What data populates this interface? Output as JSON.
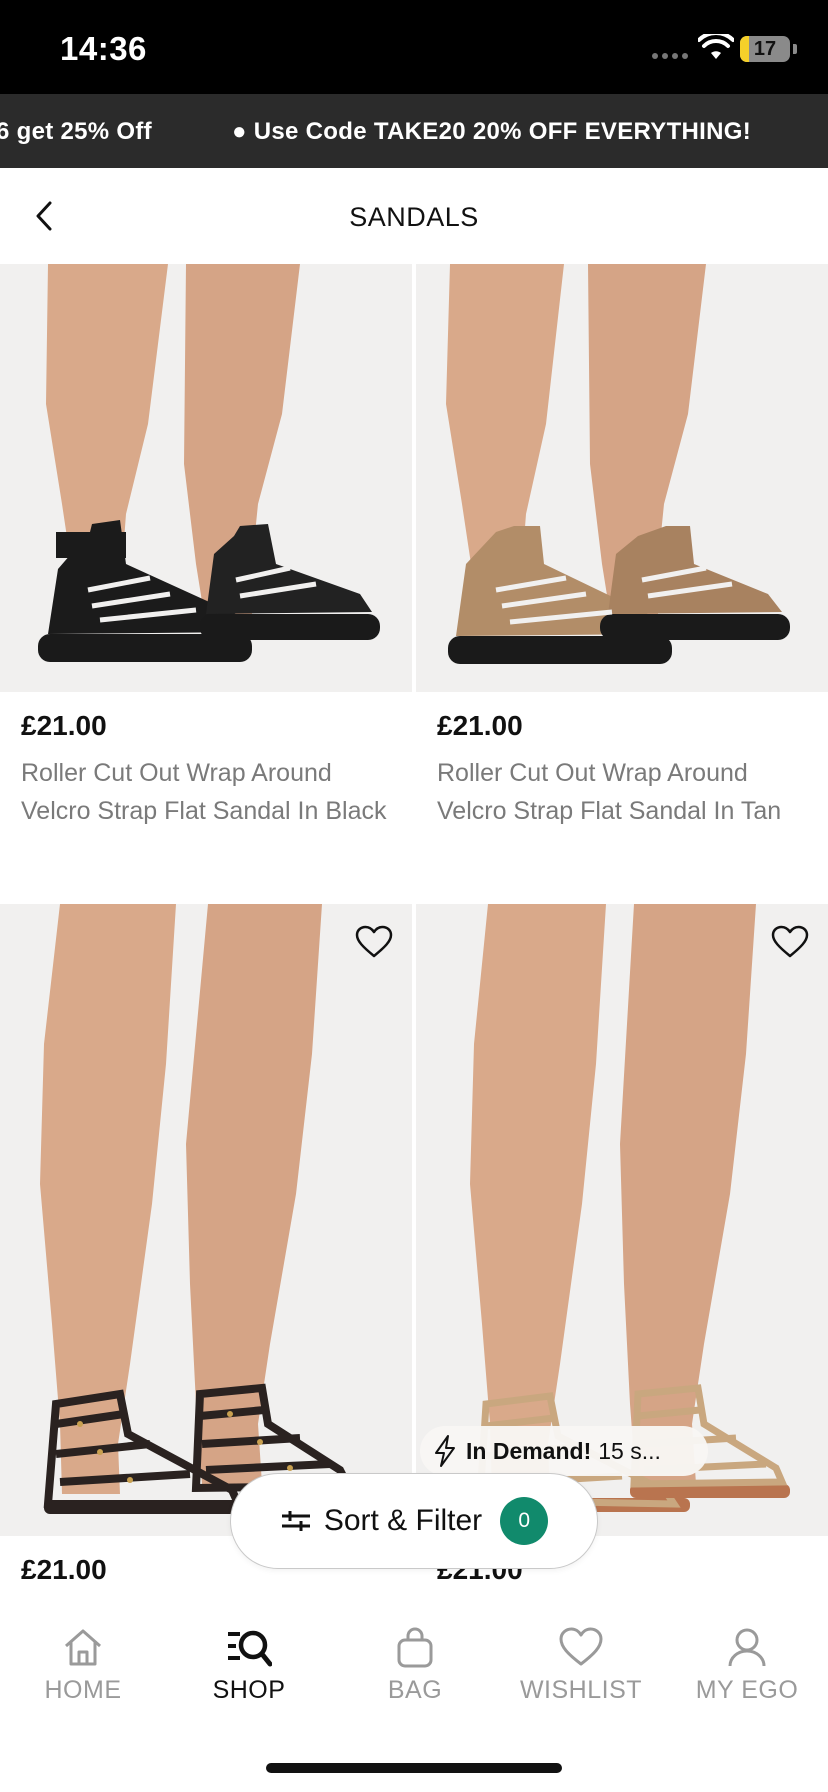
{
  "status_bar": {
    "time": "14:36",
    "battery": "17",
    "battery_level": 0.17
  },
  "promo": {
    "items": [
      "6 get 25% Off",
      "● Use Code TAKE20 20% OFF EVERYTHING!"
    ]
  },
  "header": {
    "title": "SANDALS"
  },
  "products": [
    {
      "price": "£21.00",
      "name": "Roller Cut Out Wrap Around Velcro Strap Flat Sandal In Black",
      "color": "#1b1b1b",
      "style": "velcro",
      "wishlist_visible": false
    },
    {
      "price": "£21.00",
      "name": "Roller Cut Out Wrap Around Velcro Strap Flat Sandal In Tan",
      "color": "#b28d68",
      "style": "velcro",
      "wishlist_visible": false
    },
    {
      "price": "£21.00",
      "name": "",
      "color": "#2a2220",
      "style": "gladiator",
      "wishlist_visible": true
    },
    {
      "price": "£21.00",
      "name": "",
      "color": "#c9a77f",
      "style": "gladiator",
      "wishlist_visible": true
    }
  ],
  "in_demand": {
    "title": "In Demand!",
    "text": "15 s..."
  },
  "sort_filter": {
    "label": "Sort & Filter",
    "count": "0"
  },
  "tabs": [
    {
      "label": "HOME",
      "icon": "home-icon",
      "active": false
    },
    {
      "label": "SHOP",
      "icon": "shop-search-icon",
      "active": true
    },
    {
      "label": "BAG",
      "icon": "bag-icon",
      "active": false
    },
    {
      "label": "WISHLIST",
      "icon": "heart-icon",
      "active": false
    },
    {
      "label": "MY EGO",
      "icon": "user-icon",
      "active": false
    }
  ],
  "colors": {
    "accent": "#118a6c",
    "promo_bg": "#2b2b2b",
    "image_bg": "#f1f0ef"
  }
}
